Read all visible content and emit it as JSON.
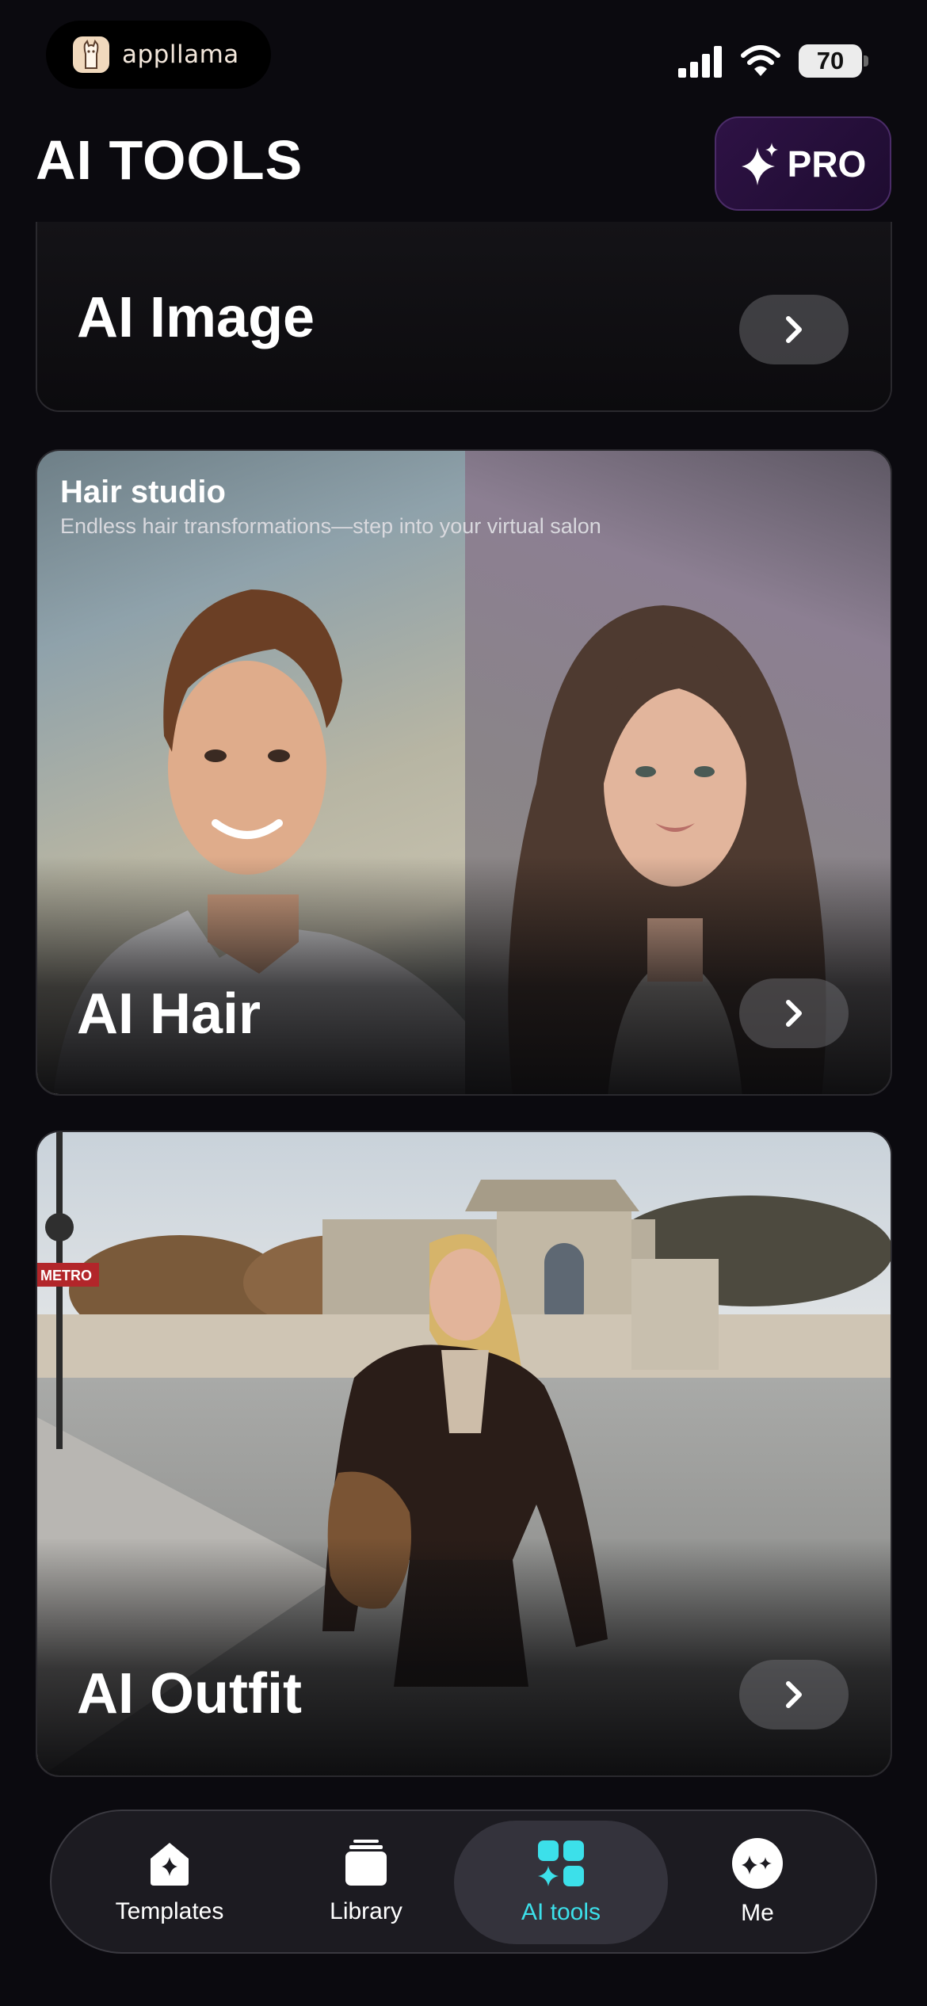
{
  "status_bar": {
    "app_name": "appllama",
    "battery": "70"
  },
  "header": {
    "title": "AI TOOLS",
    "pro_label": "PRO"
  },
  "cards": [
    {
      "title": "AI Image"
    },
    {
      "label": "Hair studio",
      "subtitle": "Endless hair transformations—step into your virtual salon",
      "title": "AI Hair"
    },
    {
      "title": "AI Outfit",
      "sign_text": "METRO"
    }
  ],
  "nav": {
    "items": [
      {
        "label": "Templates",
        "icon": "templates-icon"
      },
      {
        "label": "Library",
        "icon": "library-icon"
      },
      {
        "label": "AI tools",
        "icon": "ai-tools-icon",
        "active": true
      },
      {
        "label": "Me",
        "icon": "me-icon"
      }
    ]
  },
  "colors": {
    "background": "#0b0a0f",
    "active_tab": "#3ce0ea",
    "pro_button": "#2e1245"
  }
}
